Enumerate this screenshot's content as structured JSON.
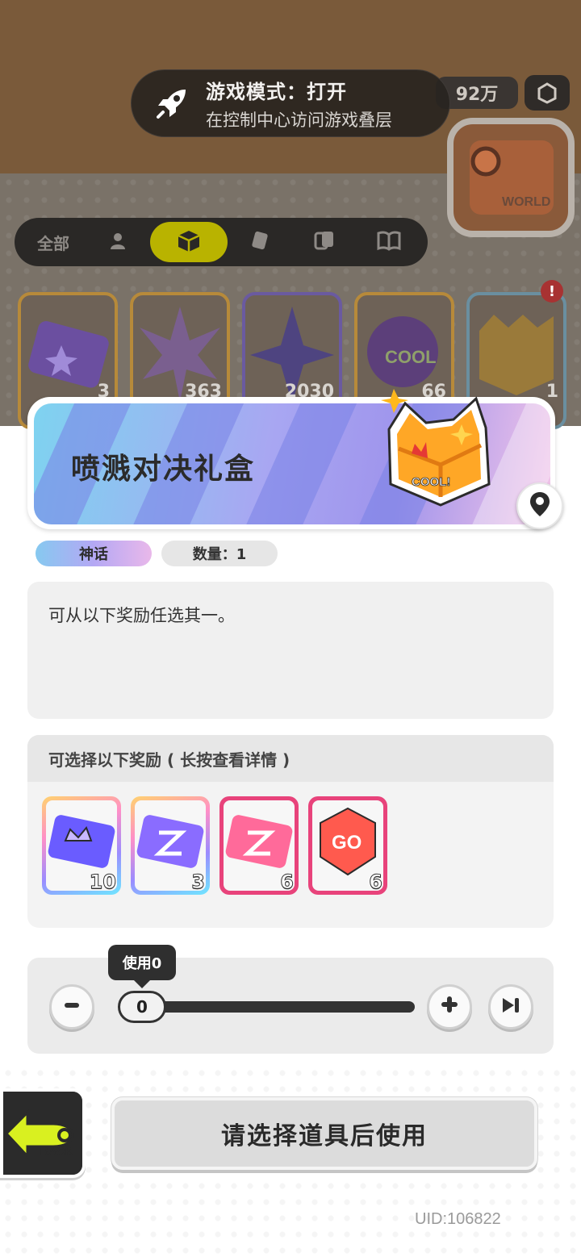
{
  "toast": {
    "title": "游戏模式：打开",
    "subtitle": "在控制中心访问游戏叠层",
    "icon": "rocket-icon"
  },
  "header": {
    "currency_value": "92万"
  },
  "category_tabs": [
    {
      "label": "全部",
      "icon": null,
      "active": false
    },
    {
      "label": "",
      "icon": "person-icon",
      "active": false
    },
    {
      "label": "",
      "icon": "box-icon",
      "active": true
    },
    {
      "label": "",
      "icon": "card-icon",
      "active": false
    },
    {
      "label": "",
      "icon": "cards-icon",
      "active": false
    },
    {
      "label": "",
      "icon": "book-icon",
      "active": false
    }
  ],
  "background_items": [
    {
      "count": "3"
    },
    {
      "count": "363"
    },
    {
      "count": "2030"
    },
    {
      "count": "66"
    },
    {
      "count": "1"
    }
  ],
  "item": {
    "name": "喷溅对决礼盒",
    "rarity": "神话",
    "quantity_label": "数量：1",
    "description": "可从以下奖励任选其一。"
  },
  "rewards": {
    "header": "可选择以下奖励 ( 长按查看详情 )",
    "items": [
      {
        "icon": "crown-ticket-icon",
        "count": "10",
        "border": "rainbow"
      },
      {
        "icon": "ticket-icon",
        "count": "3",
        "border": "rainbow"
      },
      {
        "icon": "pink-ticket-icon",
        "count": "6",
        "border": "pink"
      },
      {
        "icon": "go-gem-icon",
        "count": "6",
        "border": "pink"
      }
    ]
  },
  "slider": {
    "tooltip": "使用0",
    "value": "0",
    "min_icon": "minus-icon",
    "plus_icon": "plus-icon",
    "max_icon": "skip-max-icon"
  },
  "actions": {
    "use_label": "请选择道具后使用",
    "back_label": "BACK"
  },
  "footer": {
    "uid": "UID:106822"
  },
  "colors": {
    "active_tab": "#b9b300",
    "panel_bg": "#ffffff",
    "pink_border": "#e8437b"
  }
}
